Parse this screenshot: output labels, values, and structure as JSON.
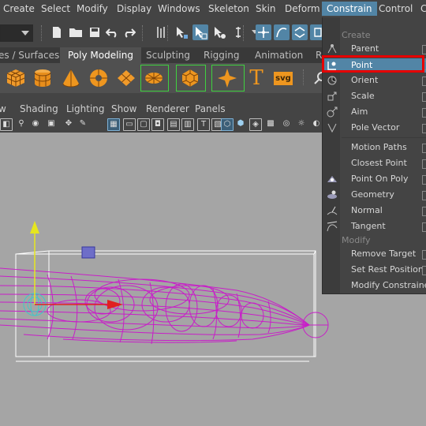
{
  "menubar": {
    "items": [
      "Create",
      "Select",
      "Modify",
      "Display",
      "Windows",
      "Skeleton",
      "Skin",
      "Deform",
      "Constrain",
      "Control",
      "C"
    ],
    "active": "Constrain"
  },
  "shelf": {
    "tabs": [
      "es / Surfaces",
      "Poly Modeling",
      "Sculpting",
      "Rigging",
      "Animation",
      "R"
    ],
    "active_tab": "Poly Modeling",
    "icons": [
      "poly-cube-icon",
      "poly-cylinder-icon",
      "poly-cone-icon",
      "poly-torus-icon",
      "poly-plane-icon",
      "poly-disc-icon",
      "platonic-icon",
      "super-shape-icon",
      "text-icon",
      "svg-icon"
    ],
    "text_glyph": "T",
    "svg_label": "svg"
  },
  "panel": {
    "menu": [
      "w",
      "Shading",
      "Lighting",
      "Show",
      "Renderer",
      "Panels"
    ]
  },
  "constrain_menu": {
    "create_header": "Create",
    "create_items": [
      "Parent",
      "Point",
      "Orient",
      "Scale",
      "Aim",
      "Pole Vector"
    ],
    "highlighted": "Point",
    "path_items": [
      "Motion Paths",
      "Closest Point",
      "Point On Poly",
      "Geometry",
      "Normal",
      "Tangent"
    ],
    "modify_header": "Modify",
    "modify_items": [
      "Remove Target",
      "Set Rest Position",
      "Modify Constraine"
    ]
  },
  "colors": {
    "accent": "#5285a6",
    "highlight_outline": "#e60000",
    "wireframe": "#c81ec8",
    "viewport_bg": "#a5a5a5",
    "shelf_green": "#3fd13f"
  }
}
